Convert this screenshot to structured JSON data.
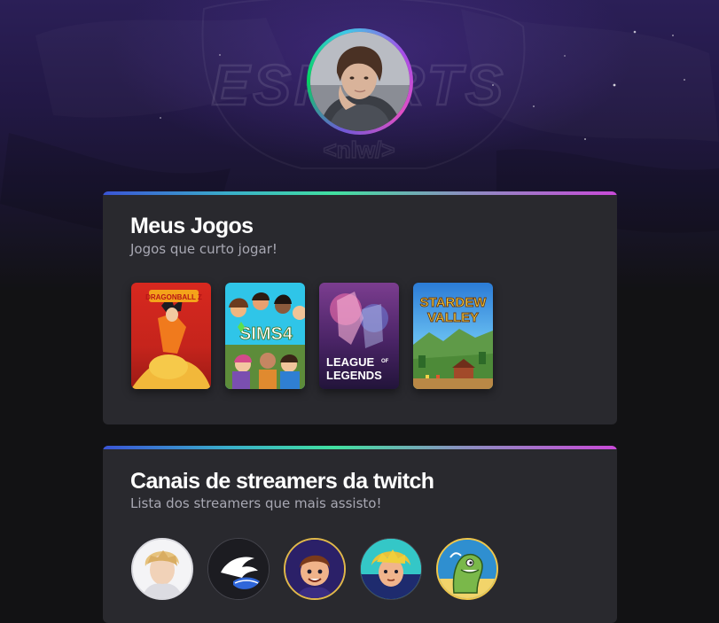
{
  "profile": {
    "avatar_alt": "Foto de perfil"
  },
  "background": {
    "logo_text": "ESPORTS",
    "logo_sub": "<nlw/>"
  },
  "games_section": {
    "title": "Meus Jogos",
    "subtitle": "Jogos que curto jogar!",
    "games": [
      {
        "name": "Dragon Ball Z Kakarot",
        "cover_text": "DRAGONBALL Z"
      },
      {
        "name": "The Sims 4",
        "cover_text": "SIMS4"
      },
      {
        "name": "League of Legends",
        "cover_line1": "LEAGUE",
        "cover_of": "OF",
        "cover_line2": "LEGENDS"
      },
      {
        "name": "Stardew Valley",
        "cover_line1": "STARDEW",
        "cover_line2": "VALLEY"
      }
    ]
  },
  "streamers_section": {
    "title": "Canais de streamers da twitch",
    "subtitle": "Lista dos streamers que mais assisto!",
    "streamers": [
      {
        "name": "streamer-1"
      },
      {
        "name": "streamer-2"
      },
      {
        "name": "streamer-3"
      },
      {
        "name": "streamer-4"
      },
      {
        "name": "streamer-5"
      }
    ]
  },
  "colors": {
    "background": "#121214",
    "card": "#29292e",
    "title": "#ffffff",
    "subtitle": "#a8a8b3",
    "accent_gradient": [
      "#3a54d6",
      "#41e0a0",
      "#c94ad8"
    ]
  }
}
